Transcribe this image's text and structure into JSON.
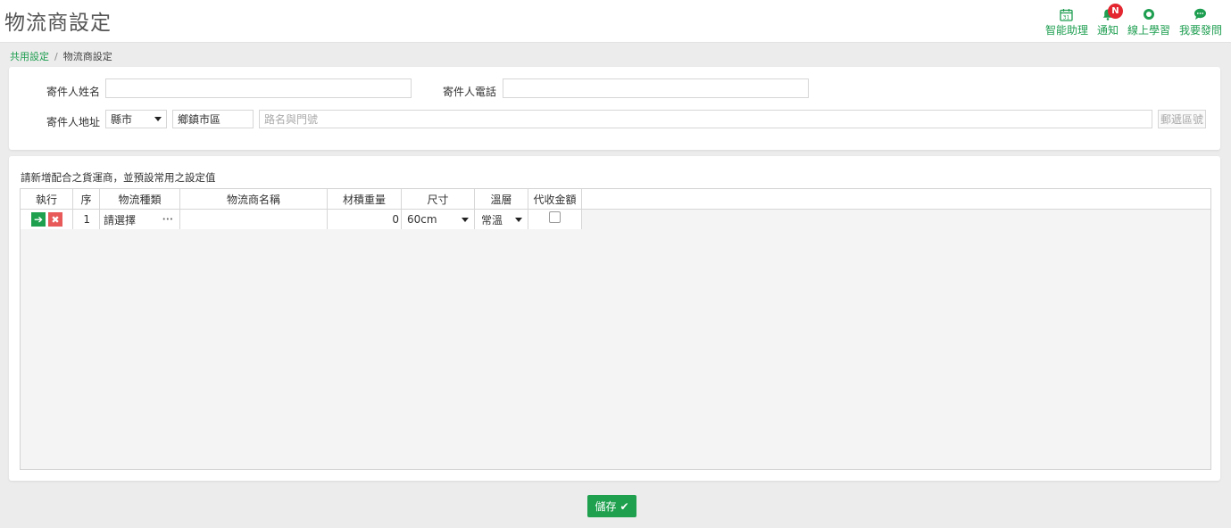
{
  "page": {
    "title": "物流商設定"
  },
  "toolbar": {
    "items": [
      {
        "label": "智能助理",
        "icon": "calendar-icon",
        "icon_text": "31"
      },
      {
        "label": "通知",
        "icon": "bell-icon",
        "badge": "N"
      },
      {
        "label": "線上學習",
        "icon": "compass-icon"
      },
      {
        "label": "我要發問",
        "icon": "chat-icon"
      }
    ]
  },
  "breadcrumb": {
    "parent": "共用設定",
    "separator": "/",
    "current": "物流商設定"
  },
  "sender": {
    "name_label": "寄件人姓名",
    "name_value": "",
    "phone_label": "寄件人電話",
    "phone_value": "",
    "address_label": "寄件人地址",
    "county_value": "縣市",
    "district_value": "鄉鎮市區",
    "road_placeholder": "路名與門號",
    "zip_label": "郵遞區號"
  },
  "carriers": {
    "intro": "請新增配合之貨運商，並預設常用之設定值",
    "columns": [
      "執行",
      "序",
      "物流種類",
      "物流商名稱",
      "材積重量",
      "尺寸",
      "溫層",
      "代收金額"
    ],
    "rows": [
      {
        "seq": "1",
        "type": "請選擇",
        "type_more": "•••",
        "name": "",
        "weight": "0",
        "size": "60cm",
        "temp": "常溫",
        "cod": false
      }
    ]
  },
  "actions": {
    "save_label": "儲存",
    "save_icon": "✔"
  },
  "colors": {
    "accent": "#1ea04e",
    "danger": "#e85a5a",
    "badge": "#e3262f"
  }
}
